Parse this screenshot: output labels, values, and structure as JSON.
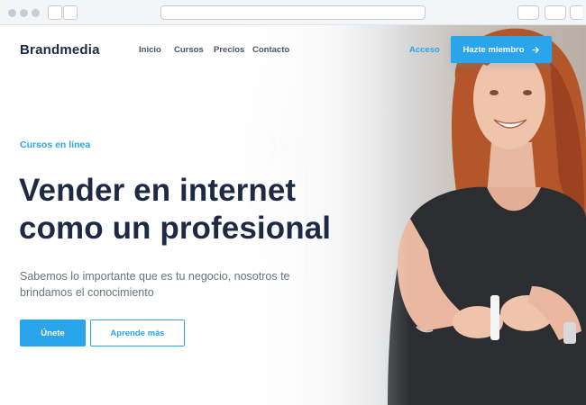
{
  "brand": {
    "name": "Brandmedia",
    "accent_color": "#2aa5ec",
    "text_color": "#1e2a44"
  },
  "nav": {
    "items": [
      {
        "label": "Inicio"
      },
      {
        "label": "Cursos"
      },
      {
        "label": "Precios"
      },
      {
        "label": "Contacto"
      }
    ],
    "login_label": "Acceso",
    "member_label": "Hazte miembro",
    "member_icon": "arrow-right-icon"
  },
  "hero": {
    "eyebrow": "Cursos en línea",
    "headline_line1": "Vender en internet",
    "headline_line2": "como un profesional",
    "subtext": "Sabemos lo importante que es tu negocio, nosotros te brindamos el conocimiento",
    "primary_cta": "Únete",
    "secondary_cta": "Aprende más"
  }
}
